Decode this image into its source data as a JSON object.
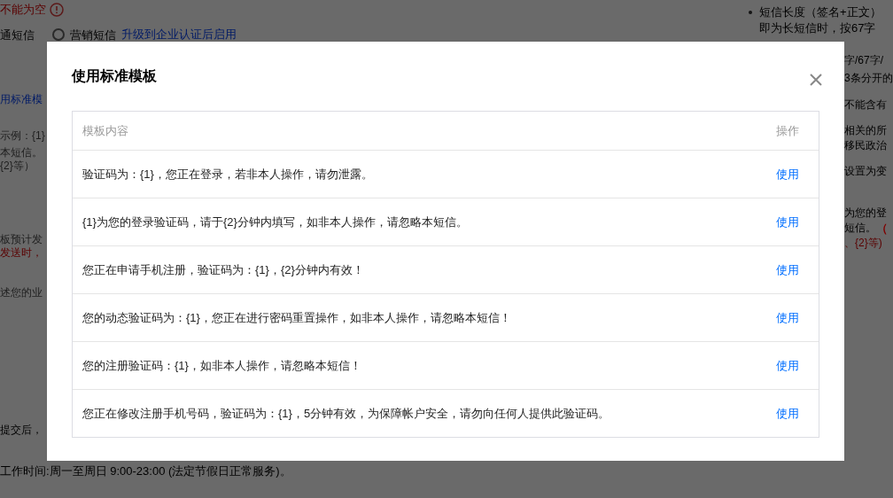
{
  "background": {
    "error_text": "不能为空",
    "sms_type_prefix": "通短信",
    "marketing_option": {
      "label": "营销短信",
      "selected": false
    },
    "upgrade_link": "升级到企业认证后启用",
    "notes_top": [
      "短信长度（签名+正文）",
      "即为长短信时，按67字"
    ],
    "left_lines": [
      {
        "parts": [
          {
            "text": "用标准模",
            "color": "#001a66"
          }
        ]
      },
      {
        "parts": [
          {
            "text": "示例：{1}",
            "color": "#1e1e1e"
          }
        ]
      },
      {
        "parts": [
          {
            "text": "本短信。",
            "color": "#1e1e1e"
          }
        ]
      },
      {
        "parts": [
          {
            "text": "{2}等）",
            "color": "#1e1e1e"
          }
        ]
      },
      {
        "parts": [
          {
            "text": "板预计发",
            "color": "#1e1e1e"
          }
        ]
      },
      {
        "parts": [
          {
            "text": "发送时，",
            "color": "#5a0000"
          }
        ]
      },
      {
        "parts": [
          {
            "text": "述您的业",
            "color": "#1e1e1e"
          }
        ]
      },
      {
        "parts": [
          {
            "text": "提交后，",
            "color": "#000000"
          }
        ]
      }
    ],
    "right_lines": [
      {
        "parts": [
          {
            "text": "字/67字/",
            "color": "#000000"
          }
        ]
      },
      {
        "parts": [
          {
            "text": "3条分开的",
            "color": "#000000"
          }
        ]
      },
      {
        "parts": [
          {
            "text": "不能含有",
            "color": "#000000"
          }
        ]
      },
      {
        "parts": [
          {
            "text": "相关的所",
            "color": "#000000"
          }
        ]
      },
      {
        "parts": [
          {
            "text": "移民政治",
            "color": "#000000"
          }
        ]
      },
      {
        "parts": [
          {
            "text": "设置为变",
            "color": "#000000"
          }
        ]
      },
      {
        "parts": [
          {
            "text": "为您的登",
            "color": "#000000"
          }
        ]
      },
      {
        "parts": [
          {
            "text": "短信。",
            "color": "#000000"
          },
          {
            "text": "（",
            "color": "#800000"
          }
        ]
      },
      {
        "parts": [
          {
            "text": "、{2}等)",
            "color": "#5a0000"
          }
        ]
      }
    ],
    "footer": "工作时间:周一至周日 9:00-23:00 (法定节假日正常服务)。"
  },
  "dialog": {
    "title": "使用标准模板",
    "columns": [
      "模板内容",
      "操作"
    ],
    "rows": [
      {
        "content": "验证码为：{1}，您正在登录，若非本人操作，请勿泄露。",
        "action": "使用"
      },
      {
        "content": "{1}为您的登录验证码，请于{2}分钟内填写，如非本人操作，请忽略本短信。",
        "action": "使用"
      },
      {
        "content": "您正在申请手机注册，验证码为：{1}，{2}分钟内有效！",
        "action": "使用"
      },
      {
        "content": "您的动态验证码为：{1}，您正在进行密码重置操作，如非本人操作，请忽略本短信！",
        "action": "使用"
      },
      {
        "content": "您的注册验证码：{1}，如非本人操作，请忽略本短信！",
        "action": "使用"
      },
      {
        "content": "您正在修改注册手机号码，验证码为：{1}，5分钟有效，为保障帐户安全，请勿向任何人提供此验证码。",
        "action": "使用"
      }
    ]
  }
}
